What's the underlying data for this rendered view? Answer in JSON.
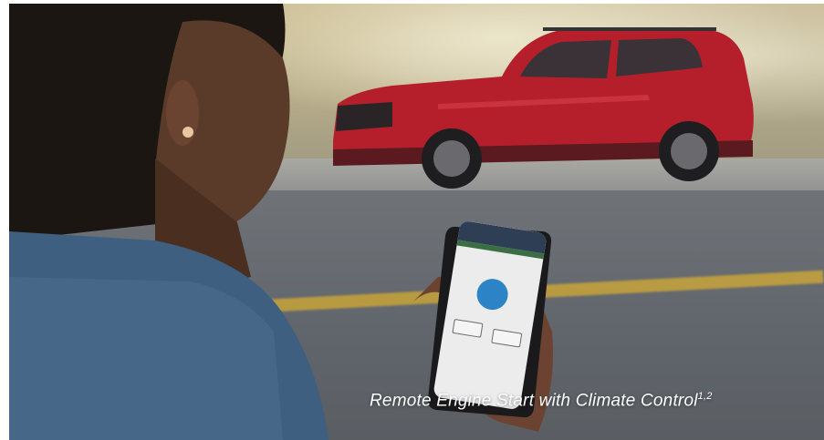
{
  "caption": {
    "text": "Remote Engine Start with Climate Control",
    "superscript": "1,2"
  },
  "colors": {
    "car_red": "#b51f2b",
    "road_line_yellow": "#c7a43a",
    "app_start_button_blue": "#2c84c6",
    "app_header_navy": "#2d3e55"
  },
  "scene": {
    "subject": "person holding smartphone with vehicle app",
    "background": "red SUV parked on street"
  }
}
